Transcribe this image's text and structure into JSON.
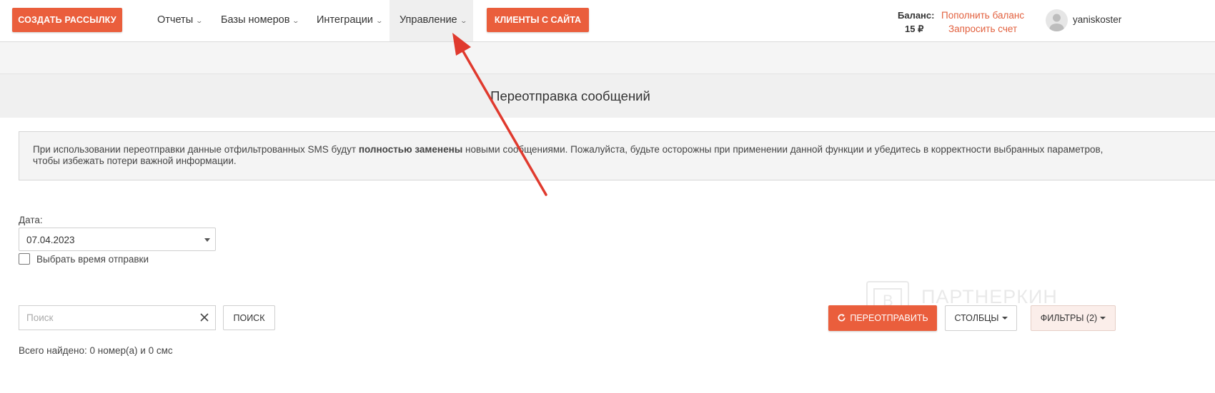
{
  "navbar": {
    "create_button": "СОЗДАТЬ РАССЫЛКУ",
    "menu": [
      {
        "label": "Отчеты"
      },
      {
        "label": "Базы номеров"
      },
      {
        "label": "Интеграции"
      },
      {
        "label": "Управление",
        "active": true
      }
    ],
    "clients_button": "КЛИЕНТЫ С САЙТА",
    "balance_label": "Баланс:",
    "balance_value": "15 ₽",
    "topup_link": "Пополнить баланс",
    "invoice_link": "Запросить счет",
    "username": "yaniskoster"
  },
  "page": {
    "title": "Переотправка сообщений"
  },
  "alert": {
    "text_before": "При использовании переотправки данные отфильтрованных SMS будут ",
    "text_bold": "полностью заменены",
    "text_after": " новыми сообщениями. Пожалуйста, будьте осторожны при применении данной функции и убедитесь в корректности выбранных параметров, чтобы избежать потери важной информации."
  },
  "filters": {
    "date_label": "Дата:",
    "date_value": "07.04.2023",
    "choose_time_label": "Выбрать время отправки",
    "choose_time_checked": false
  },
  "search": {
    "placeholder": "Поиск",
    "value": "",
    "search_button": "ПОИСК"
  },
  "actions": {
    "resend_button": "ПЕРЕОТПРАВИТЬ",
    "columns_button": "СТОЛБЦЫ",
    "filters_button": "ФИЛЬТРЫ (2)"
  },
  "summary": {
    "total_found": "Всего найдено: 0 номер(а) и 0 смс"
  },
  "watermark": {
    "text": "ПАРТНЕРКИН"
  },
  "icons": [
    "chevron-down-icon",
    "user-avatar-icon",
    "close-icon",
    "refresh-icon",
    "caret-down-icon",
    "red-arrow-annotation"
  ],
  "colors": {
    "accent": "#ea5e3c",
    "link": "#e2603e",
    "annotation_arrow": "#e03a2e",
    "header_band": "#f0f0f0"
  }
}
